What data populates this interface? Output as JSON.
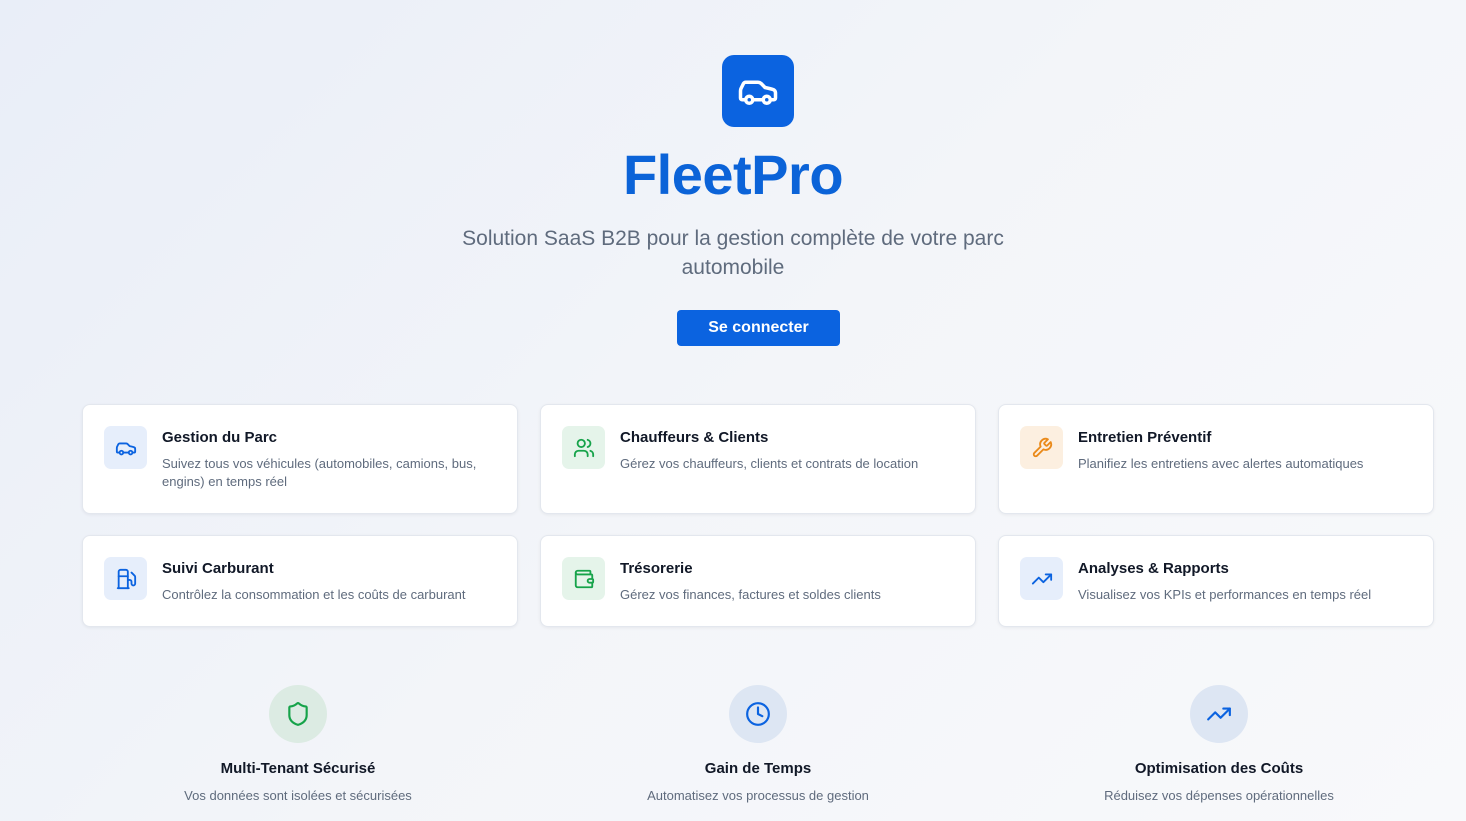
{
  "hero": {
    "logo_icon": "car-icon",
    "brand": "FleetPro",
    "tagline": "Solution SaaS B2B pour la gestion complète de votre parc automobile",
    "login_label": "Se connecter"
  },
  "colors": {
    "primary": "#0b63e0",
    "green": "#16a34a",
    "orange": "#ea8a1a"
  },
  "cards": [
    {
      "icon": "car-icon",
      "title": "Gestion du Parc",
      "desc": "Suivez tous vos véhicules (automobiles, camions, bus, engins) en temps réel"
    },
    {
      "icon": "users-icon",
      "title": "Chauffeurs & Clients",
      "desc": "Gérez vos chauffeurs, clients et contrats de location"
    },
    {
      "icon": "wrench-icon",
      "title": "Entretien Préventif",
      "desc": "Planifiez les entretiens avec alertes automatiques"
    },
    {
      "icon": "fuel-icon",
      "title": "Suivi Carburant",
      "desc": "Contrôlez la consommation et les coûts de carburant"
    },
    {
      "icon": "wallet-icon",
      "title": "Trésorerie",
      "desc": "Gérez vos finances, factures et soldes clients"
    },
    {
      "icon": "trending-up-icon",
      "title": "Analyses & Rapports",
      "desc": "Visualisez vos KPIs et performances en temps réel"
    }
  ],
  "features": [
    {
      "icon": "shield-icon",
      "title": "Multi-Tenant Sécurisé",
      "desc": "Vos données sont isolées et sécurisées"
    },
    {
      "icon": "clock-icon",
      "title": "Gain de Temps",
      "desc": "Automatisez vos processus de gestion"
    },
    {
      "icon": "trending-up-icon",
      "title": "Optimisation des Coûts",
      "desc": "Réduisez vos dépenses opérationnelles"
    }
  ]
}
